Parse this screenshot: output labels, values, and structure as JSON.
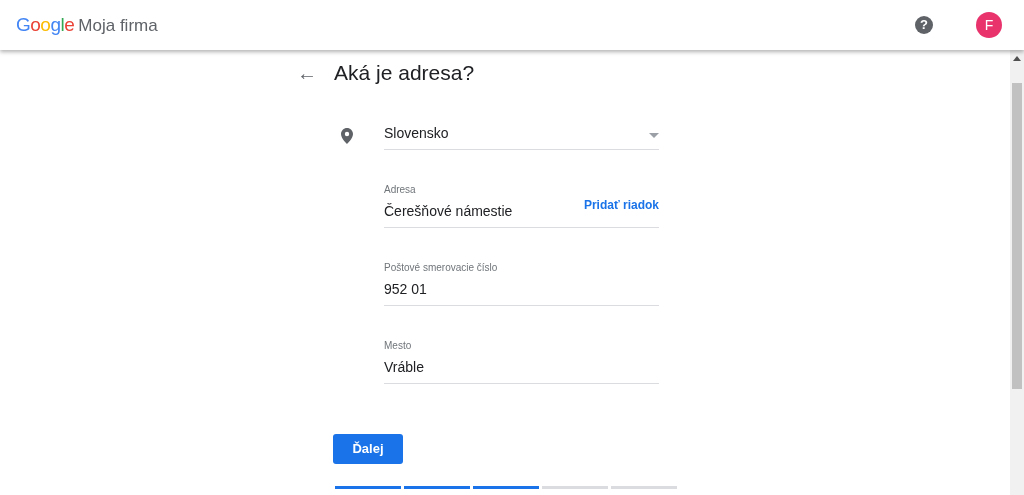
{
  "header": {
    "logo": "Google",
    "product": "Moja firma",
    "help": "?",
    "avatar": "F"
  },
  "page": {
    "back": "←",
    "title": "Aká je adresa?"
  },
  "fields": [
    {
      "kind": "select",
      "value": "Slovensko"
    },
    {
      "kind": "text",
      "label": "Adresa",
      "value": "Čerešňové námestie",
      "action": "Pridať riadok"
    },
    {
      "kind": "text",
      "label": "Poštové smerovacie číslo",
      "value": "952 01"
    },
    {
      "kind": "text",
      "label": "Mesto",
      "value": "Vráble"
    }
  ],
  "next_button": "Ďalej",
  "progress": [
    {
      "done": true
    },
    {
      "done": true
    },
    {
      "done": true
    },
    {
      "done": false
    },
    {
      "done": false
    }
  ]
}
